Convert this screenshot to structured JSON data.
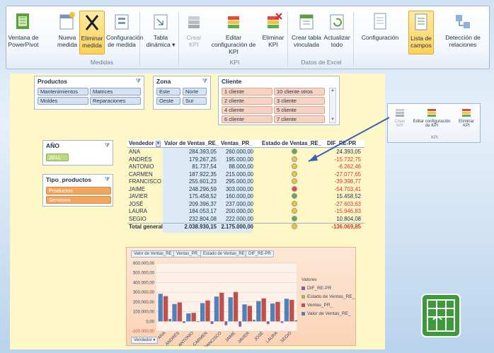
{
  "ribbon": {
    "buttons": [
      {
        "name": "powerpivot-window",
        "label": "Ventana de PowerPivot",
        "icon": "powerpivot-window-icon"
      },
      {
        "name": "new-measure",
        "label": "Nueva medida",
        "icon": "new-measure-icon"
      },
      {
        "name": "delete-measure",
        "label": "Eliminar medida",
        "icon": "delete-x-icon"
      },
      {
        "name": "measure-config",
        "label": "Configuración de medida",
        "icon": "measure-settings-icon"
      },
      {
        "name": "pivot-table",
        "label": "Tabla dinámica",
        "icon": "pivot-table-icon"
      },
      {
        "name": "create-kpi",
        "label": "Crear KPI",
        "icon": "create-kpi-icon"
      },
      {
        "name": "edit-kpi",
        "label": "Editar configuración de KPI",
        "icon": "edit-kpi-icon"
      },
      {
        "name": "delete-kpi",
        "label": "Eliminar KPI",
        "icon": "delete-kpi-icon"
      },
      {
        "name": "create-linked-table",
        "label": "Crear tabla vinculada",
        "icon": "linked-table-icon"
      },
      {
        "name": "refresh-all",
        "label": "Actualizar todo",
        "icon": "refresh-icon"
      },
      {
        "name": "settings",
        "label": "Configuración",
        "icon": "settings-doc-icon"
      },
      {
        "name": "field-list",
        "label": "Lista de campos",
        "icon": "field-list-icon"
      },
      {
        "name": "detect-relations",
        "label": "Detección de relaciones",
        "icon": "relations-icon"
      }
    ],
    "groups": {
      "measures": "Medidas",
      "kpi": "KPI",
      "excel_data": "Datos de Excel"
    },
    "pivot_dropdown": "▾"
  },
  "slicers": {
    "productos": {
      "title": "Productos",
      "items": [
        "Mantenimientos",
        "Matrices",
        "Moldes",
        "Reparaciones"
      ]
    },
    "zona": {
      "title": "Zona",
      "items": [
        "Este",
        "Norte",
        "Oeste",
        "Sur"
      ]
    },
    "cliente": {
      "title": "Cliente",
      "items": [
        "1 cliente",
        "10 cliente otros",
        "2 cliente",
        "3 cliente",
        "4 cliente",
        "5 cliente",
        "6 cliente",
        "7 cliente"
      ]
    },
    "anio": {
      "title": "AÑO",
      "items": [
        "2011"
      ]
    },
    "tipo_productos": {
      "title": "Tipo_productos",
      "items": [
        "Productos",
        "Servicios"
      ]
    }
  },
  "pivot": {
    "headers": [
      "Vendedor",
      "Valor de Ventas_RE_",
      "Ventas_PR_",
      "Estado de Ventas_RE_",
      "DIF_RE-PR"
    ],
    "rows": [
      {
        "name": "ANA",
        "real": "284.393,05",
        "pr": "260.000,00",
        "status": "green",
        "dif": "24.393,05"
      },
      {
        "name": "ANDRÉS",
        "real": "179.267,25",
        "pr": "195.000,00",
        "status": "yellow",
        "dif": "-15.732,75"
      },
      {
        "name": "ANTONIO",
        "real": "81.737,54",
        "pr": "88.000,00",
        "status": "yellow",
        "dif": "-6.262,46"
      },
      {
        "name": "CARMEN",
        "real": "187.922,35",
        "pr": "215.000,00",
        "status": "yellow",
        "dif": "-27.077,65"
      },
      {
        "name": "FRANCISCO",
        "real": "255.601,23",
        "pr": "295.000,00",
        "status": "yellow",
        "dif": "-39.398,77"
      },
      {
        "name": "JAIME",
        "real": "248.296,59",
        "pr": "303.000,00",
        "status": "red",
        "dif": "-54.703,41"
      },
      {
        "name": "JAVIER",
        "real": "175.458,52",
        "pr": "160.000,00",
        "status": "green",
        "dif": "15.458,52"
      },
      {
        "name": "JOSÉ",
        "real": "209.396,37",
        "pr": "237.000,00",
        "status": "yellow",
        "dif": "-27.603,63"
      },
      {
        "name": "LAURA",
        "real": "184.053,17",
        "pr": "200.000,00",
        "status": "yellow",
        "dif": "-15.946,83"
      },
      {
        "name": "SEGIO",
        "real": "232.804,08",
        "pr": "222.000,00",
        "status": "green",
        "dif": "10.804,08"
      }
    ],
    "total": {
      "name": "Total general",
      "real": "2.038.930,15",
      "pr": "2.175.000,00",
      "status": "yellow",
      "dif": "-136.069,85"
    }
  },
  "chart_data": {
    "type": "bar",
    "tabs": [
      "Valor de Ventas_RE_",
      "Ventas_PR_",
      "Estado de Ventas_RE_",
      "DIF_RE-PR"
    ],
    "categories": [
      "ANA",
      "ANDRÉS",
      "ANTONIO",
      "CARMEN",
      "FRANCISCO",
      "JAIME",
      "JAVIER",
      "JOSÉ",
      "LAURA",
      "SEGIO"
    ],
    "series": [
      {
        "name": "Valor de Ventas_RE_",
        "values": [
          284393.05,
          179267.25,
          81737.54,
          187922.35,
          255601.23,
          248296.59,
          175458.52,
          209396.37,
          184053.17,
          232804.08
        ]
      },
      {
        "name": "Ventas_PR_",
        "values": [
          260000,
          195000,
          88000,
          215000,
          295000,
          303000,
          160000,
          237000,
          200000,
          222000
        ]
      },
      {
        "name": "DIF_RE-PR",
        "values": [
          24393.05,
          -15732.75,
          -6262.46,
          -27077.65,
          -39398.77,
          -54703.41,
          15458.52,
          -27603.63,
          -15946.83,
          10804.08
        ]
      }
    ],
    "legend_title": "Valores",
    "legend": [
      "DIF_RE-PR",
      "Estado de Ventas_RE_",
      "Ventas_PR_",
      "Valor de Ventas_RE_"
    ],
    "yticks": [
      "600.000,00",
      "500.000,00",
      "400.000,00",
      "300.000,00",
      "200.000,00",
      "100.000,00",
      "0,00",
      "-100.000,00"
    ],
    "ylim": [
      -100000,
      600000
    ],
    "axis_filter": "Vendedor",
    "colors": {
      "blue": "#4f81bd",
      "red": "#c0504d",
      "green": "#9bbb59",
      "purple": "#8064a2"
    }
  },
  "mini_panel": {
    "buttons": [
      "Crear KPI",
      "Editar configuración de KPI",
      "Eliminar KPI"
    ],
    "group": "KPI"
  }
}
